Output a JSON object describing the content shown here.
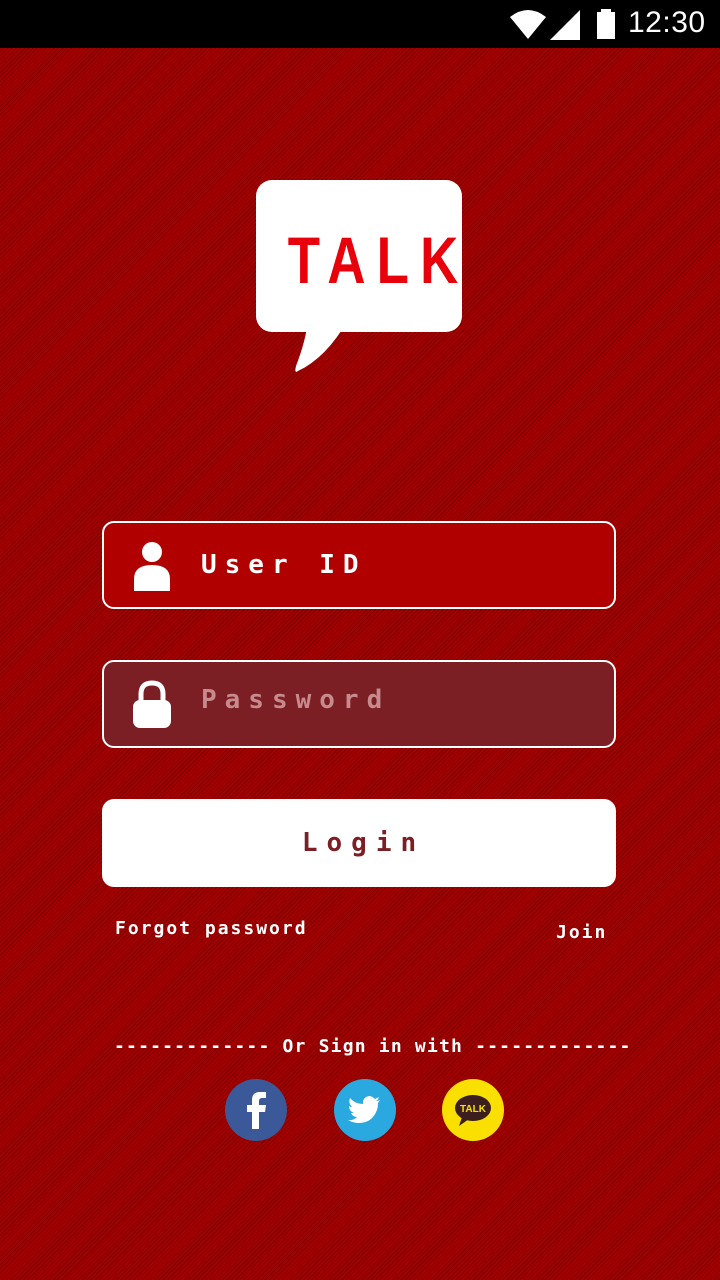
{
  "status_bar": {
    "time": "12:30",
    "icons": [
      "wifi-icon",
      "cell-signal-icon",
      "battery-icon"
    ]
  },
  "logo": {
    "text": "TALK"
  },
  "form": {
    "user_id": {
      "placeholder": "User ID",
      "icon": "user-icon"
    },
    "password": {
      "placeholder": "Password",
      "icon": "lock-icon"
    },
    "login_label": "Login"
  },
  "links": {
    "forgot_password": "Forgot password",
    "join": "Join"
  },
  "social": {
    "divider": "------------- Or Sign in with -------------",
    "providers": [
      {
        "name": "facebook",
        "icon": "facebook-icon",
        "color": "#3b5998"
      },
      {
        "name": "twitter",
        "icon": "twitter-icon",
        "color": "#29a9e0"
      },
      {
        "name": "kakaotalk",
        "icon": "kakaotalk-icon",
        "label": "TALK",
        "color": "#f9e000"
      }
    ]
  },
  "colors": {
    "background": "#a30000",
    "user_field": "#b00000",
    "password_field": "#7b1f24",
    "logo_text": "#e8000b"
  }
}
